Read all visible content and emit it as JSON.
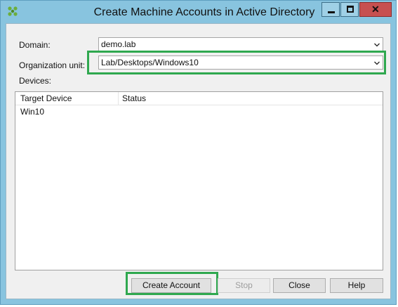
{
  "window": {
    "title": "Create Machine Accounts in Active Directory",
    "controls": {
      "minimize": "—",
      "maximize": "□",
      "close": "✕"
    }
  },
  "form": {
    "domain_label": "Domain:",
    "domain_value": "demo.lab",
    "ou_label": "Organization unit:",
    "ou_value": "Lab/Desktops/Windows10",
    "devices_label": "Devices:"
  },
  "devices_table": {
    "columns": [
      "Target Device",
      "Status"
    ],
    "rows": [
      {
        "target_device": "Win10",
        "status": ""
      }
    ]
  },
  "buttons": {
    "create_account": "Create Account",
    "stop": "Stop",
    "close": "Close",
    "help": "Help"
  },
  "colors": {
    "highlight": "#2fa84f",
    "titlebar": "#88c4df",
    "close_button": "#c75050"
  },
  "icons": {
    "app": "citrix-app-icon",
    "dropdown": "chevron-down-icon"
  }
}
